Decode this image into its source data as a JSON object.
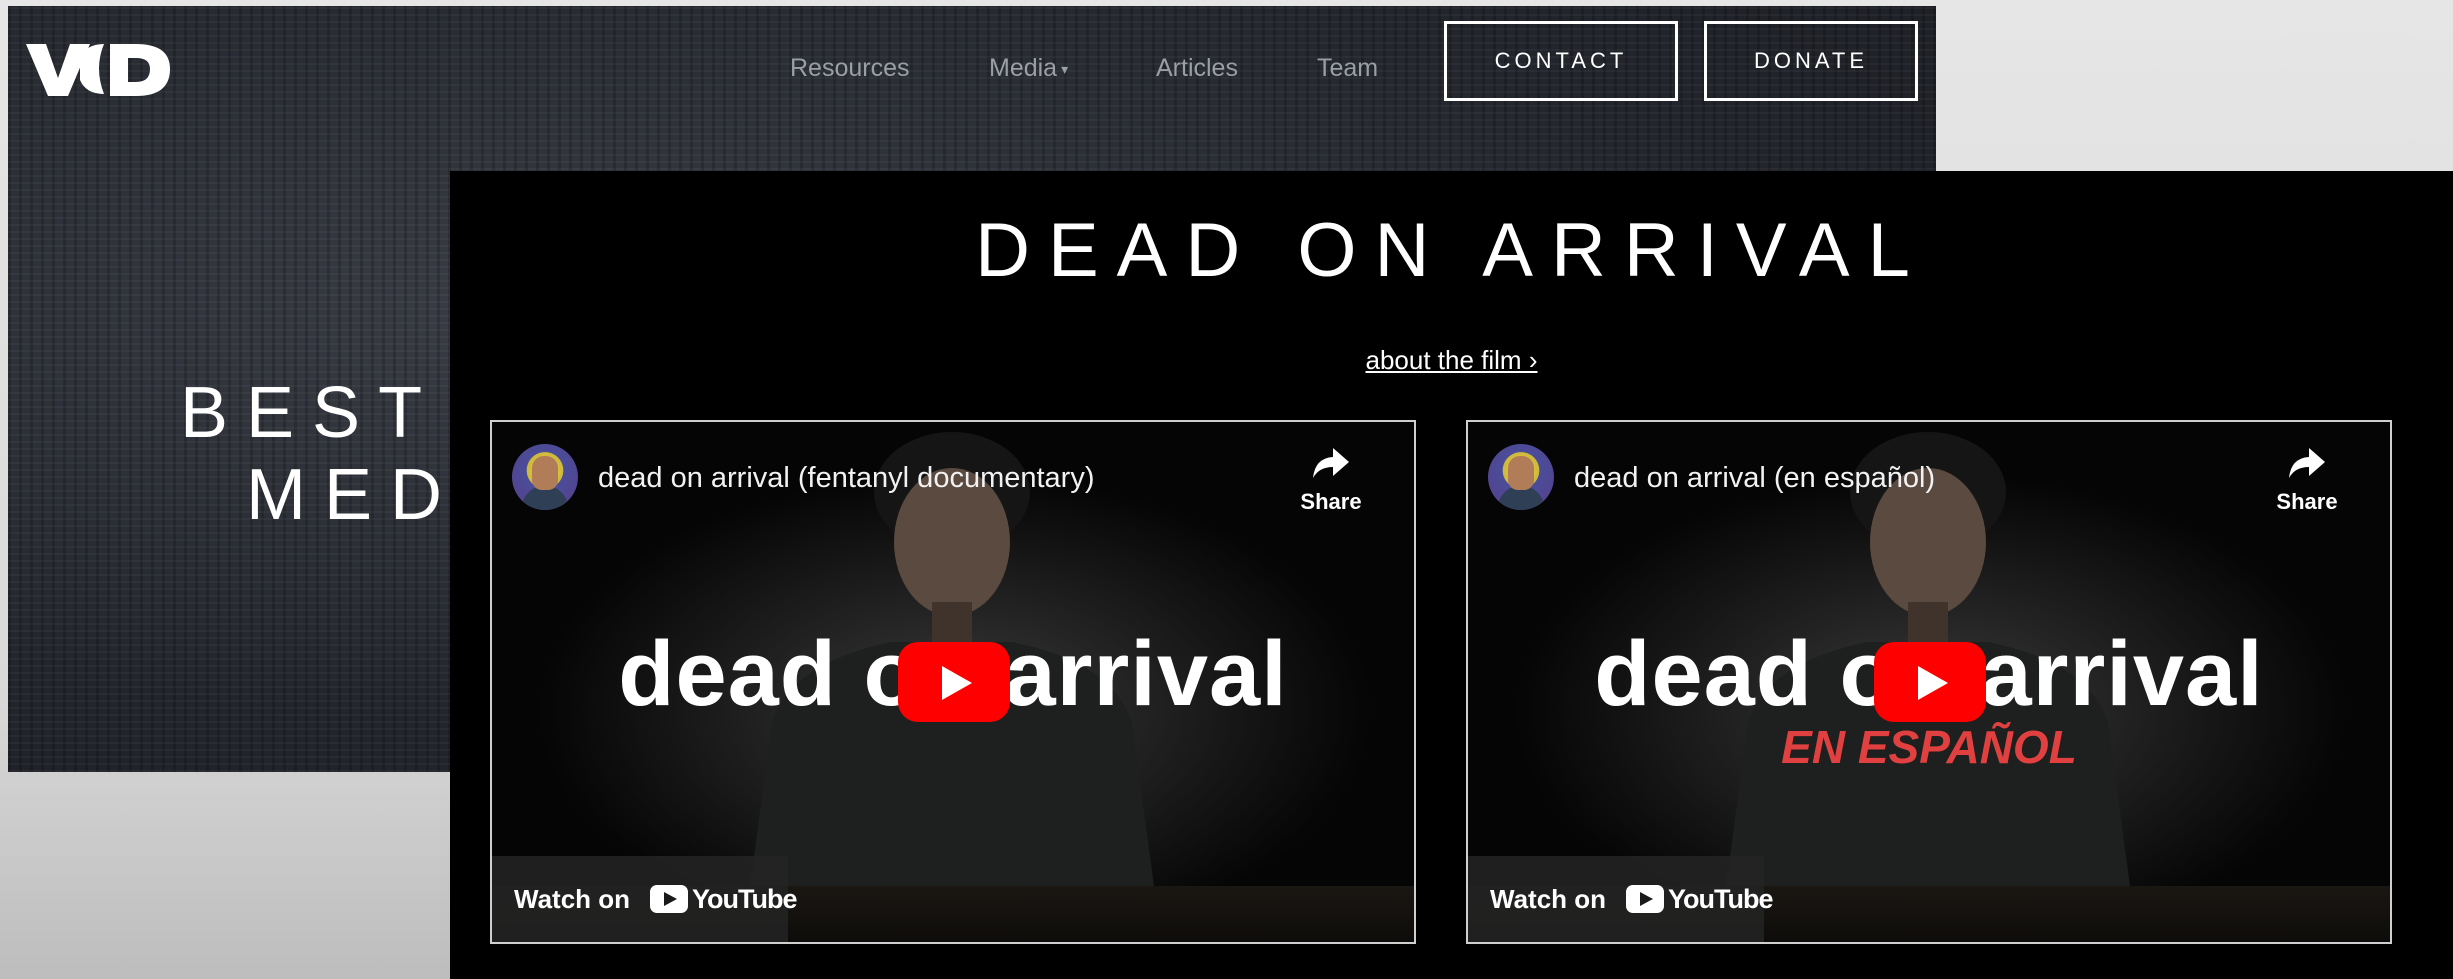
{
  "site": {
    "logo_text": "VOD",
    "nav": {
      "links": [
        "Resources",
        "Media",
        "Articles",
        "Team"
      ],
      "media_has_dropdown": true,
      "contact_label": "CONTACT",
      "donate_label": "DONATE"
    },
    "hero": {
      "line1": "BEST",
      "line2": "MED"
    }
  },
  "film_section": {
    "title": "DEAD ON ARRIVAL",
    "about_link": "about the film ›",
    "videos": [
      {
        "title": "dead on arrival (fentanyl documentary)",
        "thumbnail_text": "dead on arrival",
        "thumbnail_subtitle": "",
        "share_label": "Share",
        "watch_label": "Watch on",
        "platform": "YouTube"
      },
      {
        "title": "dead on arrival (en español)",
        "thumbnail_text": "dead on arrival",
        "thumbnail_subtitle": "EN ESPAÑOL",
        "share_label": "Share",
        "watch_label": "Watch on",
        "platform": "YouTube"
      }
    ]
  },
  "colors": {
    "page_bg": "#dcdcdc",
    "header_bg": "#2a2d33",
    "section_bg": "#000000",
    "youtube_red": "#ff0000",
    "spanish_subtitle": "#e0403f"
  },
  "icons": [
    "share-icon",
    "play-icon",
    "youtube-logo-icon",
    "chevron-down-icon"
  ]
}
